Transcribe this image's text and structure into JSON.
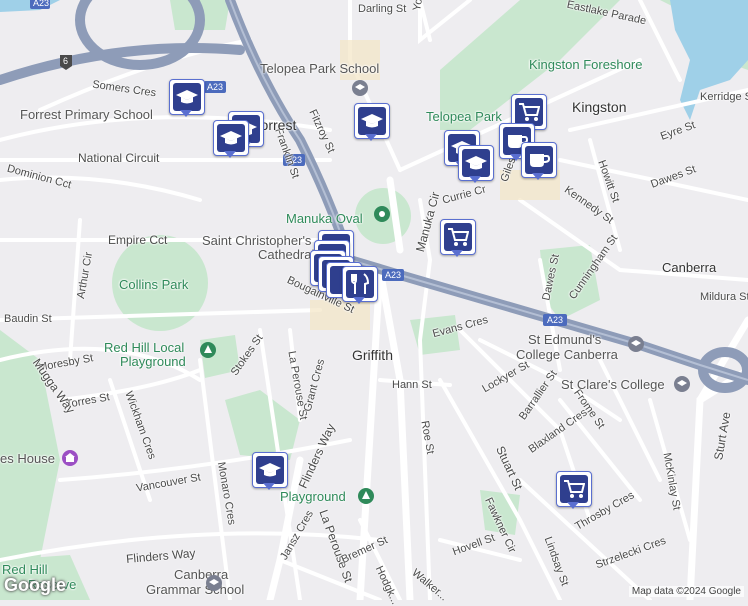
{
  "roads": {
    "darling": "Darling St",
    "young": "Young St",
    "eastlake": "Eastlake Parade",
    "somers": "Somers Cres",
    "national": "National Circuit",
    "dominion": "Dominion Cct",
    "empire": "Empire Cct",
    "fitzroy": "Fitzroy St",
    "franklin": "Franklin St",
    "manuka_cir": "Manuka Cir",
    "giles": "Giles St",
    "currie": "Currie Cr",
    "eyre": "Eyre St",
    "dawes_n": "Dawes St",
    "kennedy": "Kennedy St",
    "howitt": "Howitt St",
    "kerridge": "Kerridge St",
    "arthur": "Arthur Cir",
    "bougainville": "Bougainville St",
    "baudin": "Baudin St",
    "moresby": "Moresby St",
    "stokes": "Stokes St",
    "la_perouse_n": "La Perouse St",
    "grant": "Grant Cres",
    "evans": "Evans Cres",
    "dawes_s": "Dawes St",
    "cunningham": "Cunningham St",
    "mildura": "Mildura St",
    "hann": "Hann St",
    "lockyer": "Lockyer St",
    "barrallier": "Barrallier St",
    "frome": "Frome St",
    "torres": "Torres St",
    "wickham": "Wickham Cres",
    "mugga": "Mugga Way",
    "roe": "Roe St",
    "blaxland": "Blaxland Cres",
    "stuart": "Stuart St",
    "mckinlay": "McKinlay St",
    "sturt": "Sturt Ave",
    "vancouver": "Vancouver St",
    "monaro": "Monaro Cres",
    "flinders_n": "Flinders Way",
    "flinders_s": "Flinders Way",
    "la_perouse_s": "La Perouse St",
    "jansz": "Jansz Cres",
    "bremer": "Bremer St",
    "hodgkinson": "Hodgk...",
    "walker": "Walker...",
    "hovell": "Hovell St",
    "fawkner": "Fawkner Cir",
    "lindsay": "Lindsay St",
    "throsby": "Throsby Cres",
    "strzelecki": "Strzelecki Cres",
    "a23_top": "A23",
    "a23_mid": "A23",
    "a23_right": "A23",
    "a23_center": "A23",
    "route6": "6"
  },
  "places": {
    "kingston": "Kingston",
    "griffith": "Griffith",
    "forrest": "Forrest",
    "canberra": "Canberra",
    "telopea_school": "Telopea Park School",
    "kingston_foreshore": "Kingston Foreshore",
    "forrest_primary": "Forrest Primary School",
    "telopea_park": "Telopea Park",
    "manuka_oval": "Manuka Oval",
    "st_christophers": "Saint Christopher's",
    "cathedral": "Cathedral",
    "collins_park": "Collins Park",
    "red_hill_playground_1": "Red Hill Local",
    "red_hill_playground_2": "Playground",
    "st_edmunds_1": "St Edmund's",
    "st_edmunds_2": "College Canberra",
    "st_clares": "St Clare's College",
    "house": "es House",
    "playground": "Playground",
    "canberra_grammar_1": "Canberra",
    "canberra_grammar_2": "Grammar School",
    "red_hill_reserve_1": "Red Hill",
    "red_hill_reserve_2": "Reserve"
  },
  "markers": [
    {
      "type": "school",
      "icon": "graduation-cap-icon"
    },
    {
      "type": "school",
      "icon": "graduation-cap-icon"
    },
    {
      "type": "school",
      "icon": "graduation-cap-icon"
    },
    {
      "type": "school",
      "icon": "graduation-cap-icon"
    },
    {
      "type": "school",
      "icon": "graduation-cap-icon"
    },
    {
      "type": "school",
      "icon": "graduation-cap-icon"
    },
    {
      "type": "shop",
      "icon": "shopping-cart-icon"
    },
    {
      "type": "shop",
      "icon": "shopping-cart-icon"
    },
    {
      "type": "shop",
      "icon": "shopping-cart-icon"
    },
    {
      "type": "cafe",
      "icon": "coffee-cup-icon"
    },
    {
      "type": "cafe",
      "icon": "coffee-cup-icon"
    },
    {
      "type": "restaurant",
      "icon": "fork-knife-icon"
    }
  ],
  "colors": {
    "background": "#eeedf0",
    "park": "#c9e7cf",
    "water": "#9fd0e8",
    "highway": "#8e9cb8",
    "marker": "#2f3f8e"
  },
  "footer": {
    "logo": "Google",
    "attribution": "Map data ©2024 Google"
  }
}
